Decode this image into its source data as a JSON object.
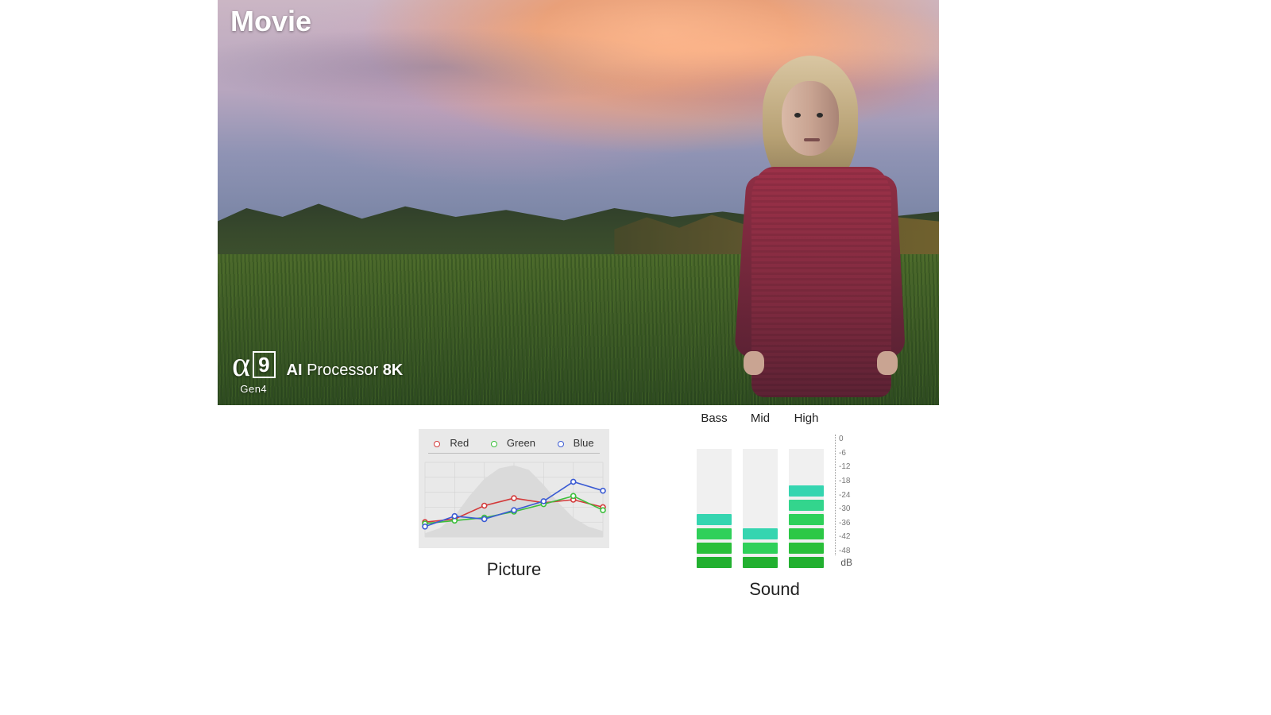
{
  "hero": {
    "title": "Movie",
    "processor": {
      "alpha": "α",
      "nine": "9",
      "gen": "Gen4",
      "ai": "AI",
      "label": "Processor",
      "res": "8K"
    }
  },
  "picture_panel": {
    "label": "Picture",
    "legend": {
      "red": "Red",
      "green": "Green",
      "blue": "Blue"
    }
  },
  "sound_panel": {
    "label": "Sound",
    "channels": {
      "bass": "Bass",
      "mid": "Mid",
      "high": "High"
    },
    "db_unit": "dB"
  },
  "chart_data": [
    {
      "type": "line",
      "title": "Picture",
      "x": [
        0,
        1,
        2,
        3,
        4,
        5,
        6
      ],
      "series": [
        {
          "name": "Red",
          "color": "#d33a3a",
          "values": [
            20,
            24,
            42,
            52,
            46,
            50,
            40
          ]
        },
        {
          "name": "Green",
          "color": "#3bbf3b",
          "values": [
            18,
            22,
            26,
            34,
            44,
            55,
            36
          ]
        },
        {
          "name": "Blue",
          "color": "#3b5bd3",
          "values": [
            14,
            28,
            24,
            36,
            48,
            74,
            62
          ]
        }
      ],
      "histogram": [
        5,
        12,
        28,
        55,
        78,
        92,
        96,
        90,
        70,
        46,
        26,
        14,
        8
      ],
      "ylim": [
        0,
        100
      ],
      "legend_position": "top"
    },
    {
      "type": "bar",
      "title": "Sound",
      "ylabel": "dB",
      "ylim": [
        -48,
        0
      ],
      "db_ticks": [
        0,
        -6,
        -12,
        -18,
        -24,
        -30,
        -36,
        -42,
        -48
      ],
      "channels": [
        {
          "name": "Bass",
          "segments": [
            {
              "db": -30,
              "color": "#35d5b0"
            },
            {
              "db": -36,
              "color": "#2fd05a"
            },
            {
              "db": -42,
              "color": "#2abf3a"
            },
            {
              "db": -48,
              "color": "#22b030"
            }
          ]
        },
        {
          "name": "Mid",
          "segments": [
            {
              "db": -36,
              "color": "#35d5b0"
            },
            {
              "db": -42,
              "color": "#2fd05a"
            },
            {
              "db": -48,
              "color": "#22b030"
            }
          ]
        },
        {
          "name": "High",
          "segments": [
            {
              "db": -18,
              "color": "#35d5b0"
            },
            {
              "db": -24,
              "color": "#33d58d"
            },
            {
              "db": -30,
              "color": "#2fd05a"
            },
            {
              "db": -36,
              "color": "#2cc846"
            },
            {
              "db": -42,
              "color": "#2abf3a"
            },
            {
              "db": -48,
              "color": "#22b030"
            }
          ]
        }
      ]
    }
  ]
}
